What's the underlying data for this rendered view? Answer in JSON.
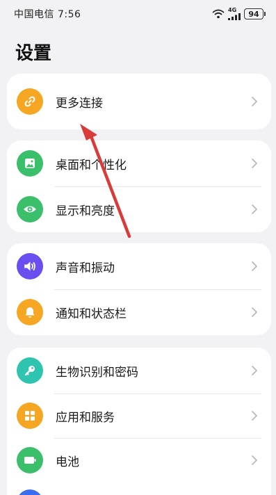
{
  "status_bar": {
    "carrier_time": "中国电信 7:56",
    "network": "4G",
    "battery": "94",
    "icons": [
      "wifi-icon",
      "signal-icon",
      "battery-icon"
    ]
  },
  "page": {
    "title": "设置"
  },
  "cards": [
    {
      "items": [
        {
          "label": "更多连接",
          "icon": "link-icon",
          "color": "#f5a623"
        }
      ]
    },
    {
      "items": [
        {
          "label": "桌面和个性化",
          "icon": "image-icon",
          "color": "#3bbf6a"
        },
        {
          "label": "显示和亮度",
          "icon": "eye-icon",
          "color": "#3bbf6a"
        }
      ]
    },
    {
      "items": [
        {
          "label": "声音和振动",
          "icon": "speaker-icon",
          "color": "#6a4ff0"
        },
        {
          "label": "通知和状态栏",
          "icon": "bell-icon",
          "color": "#f5a623"
        }
      ]
    },
    {
      "items": [
        {
          "label": "生物识别和密码",
          "icon": "key-icon",
          "color": "#2ec4b0"
        },
        {
          "label": "应用和服务",
          "icon": "apps-icon",
          "color": "#f5a623"
        },
        {
          "label": "电池",
          "icon": "battery-icon",
          "color": "#3bbf6a"
        }
      ]
    }
  ],
  "annotation": {
    "color": "#d93a3a"
  }
}
